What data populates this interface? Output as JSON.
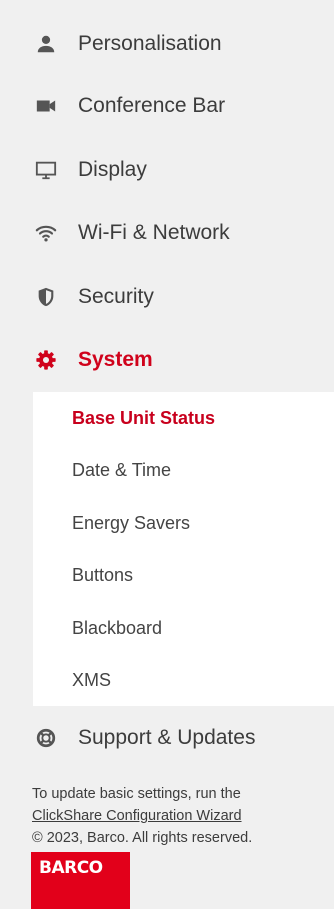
{
  "nav": {
    "items": [
      {
        "label": "Personalisation",
        "icon": "person-icon"
      },
      {
        "label": "Conference Bar",
        "icon": "camera-icon"
      },
      {
        "label": "Display",
        "icon": "monitor-icon"
      },
      {
        "label": "Wi-Fi & Network",
        "icon": "wifi-icon"
      },
      {
        "label": "Security",
        "icon": "shield-icon"
      },
      {
        "label": "System",
        "icon": "gear-icon",
        "active": true
      },
      {
        "label": "Support & Updates",
        "icon": "lifebuoy-icon"
      }
    ],
    "system_submenu": [
      {
        "label": "Base Unit Status",
        "active": true
      },
      {
        "label": "Date & Time"
      },
      {
        "label": "Energy Savers"
      },
      {
        "label": "Buttons"
      },
      {
        "label": "Blackboard"
      },
      {
        "label": "XMS"
      }
    ]
  },
  "footer": {
    "line1": "To update basic settings, run the",
    "wizard_link": "ClickShare Configuration Wizard",
    "copyright": "© 2023, Barco. All rights reserved."
  },
  "logo": {
    "text": "BARCO"
  },
  "colors": {
    "accent": "#d0021b",
    "background": "#f0f0f0",
    "submenu_bg": "#ffffff",
    "logo_bg": "#e2001a"
  }
}
